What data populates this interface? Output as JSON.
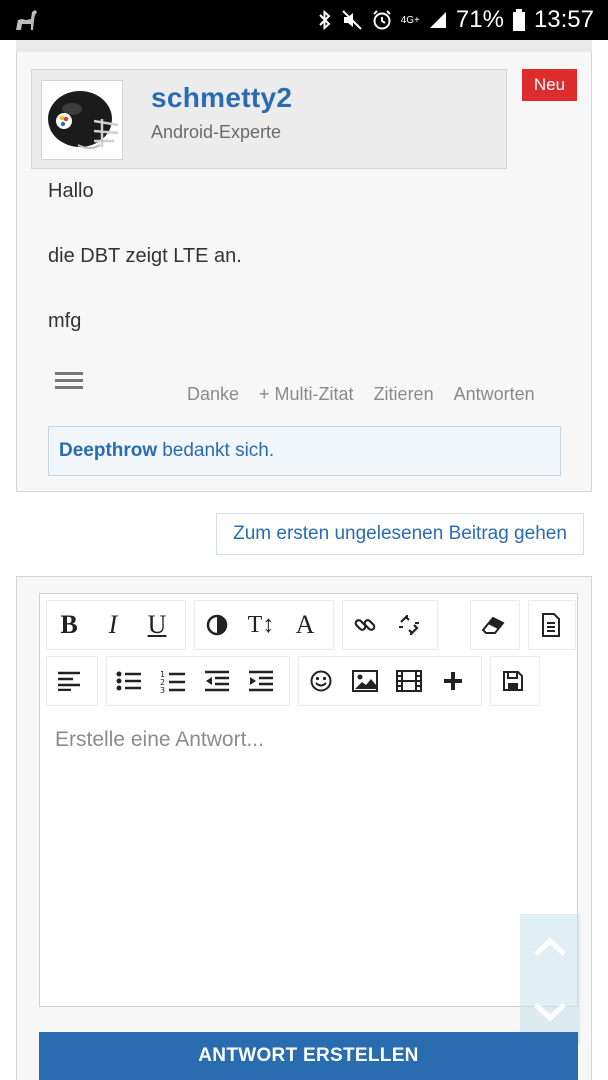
{
  "status_bar": {
    "network": "4G+",
    "battery": "71%",
    "time": "13:57"
  },
  "post": {
    "author_name": "schmetty2",
    "author_role": "Android-Experte",
    "new_badge": "Neu",
    "lines": [
      "Hallo",
      "die DBT zeigt LTE an.",
      "mfg"
    ],
    "actions": [
      "Danke",
      "+ Multi-Zitat",
      "Zitieren",
      "Antworten"
    ],
    "thanks_user": "Deepthrow",
    "thanks_text": "bedankt sich."
  },
  "unread_link": "Zum ersten ungelesenen Beitrag gehen",
  "editor": {
    "placeholder": "Erstelle eine Antwort...",
    "toolbar_row1": [
      "bold-icon",
      "italic-icon",
      "underline-icon",
      "contrast-icon",
      "text-size-icon",
      "font-icon",
      "link-icon",
      "unlink-icon",
      "eraser-icon",
      "document-icon"
    ],
    "toolbar_row2": [
      "align-left-icon",
      "bullet-list-icon",
      "numbered-list-icon",
      "outdent-icon",
      "indent-icon",
      "smiley-icon",
      "image-icon",
      "film-icon",
      "plus-icon",
      "save-icon"
    ],
    "bold_glyph": "B",
    "italic_glyph": "I",
    "underline_glyph": "U",
    "text_size_glyph": "T↕",
    "font_glyph": "A"
  },
  "submit_button": "ANTWORT ERSTELLEN",
  "colors": {
    "accent": "#2a6cb0",
    "badge": "#dd2c2c"
  }
}
